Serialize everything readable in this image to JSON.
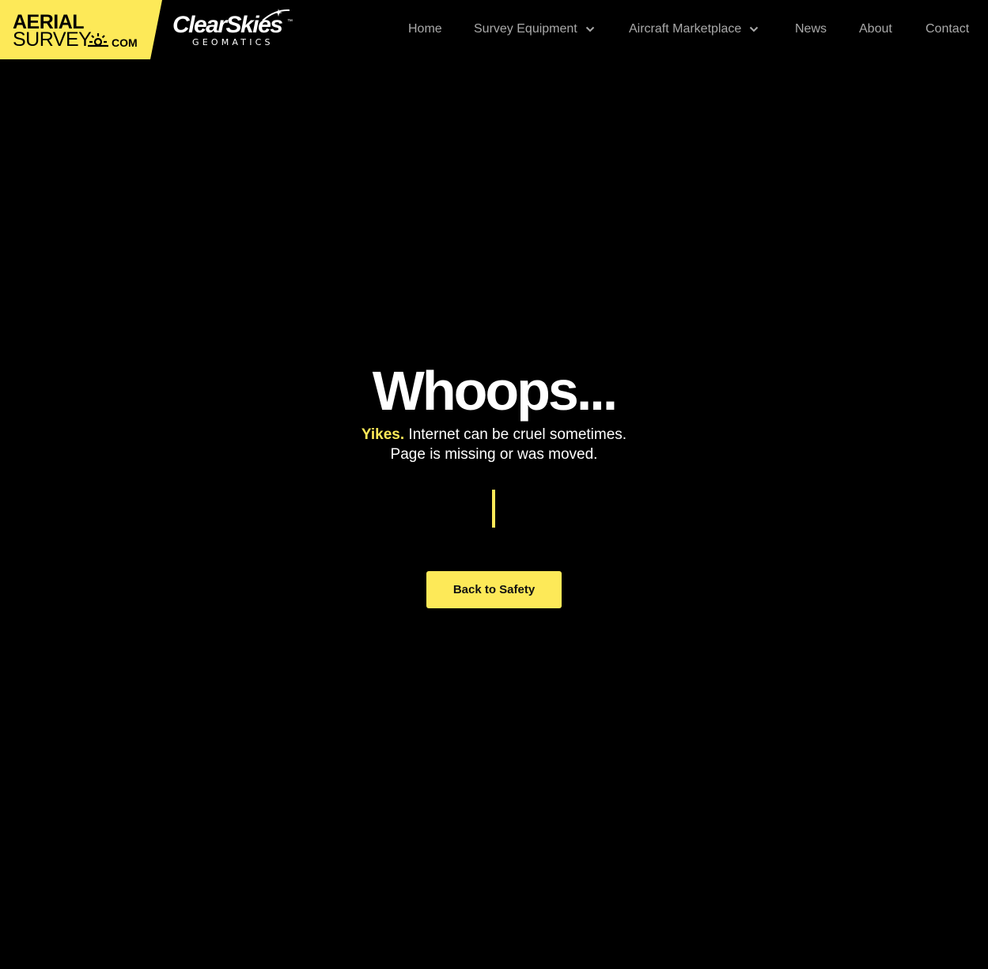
{
  "header": {
    "brand_aerial": {
      "line1": "AERIAL",
      "line2": "SURVEY",
      "suffix": "COM",
      "color": "#fde958"
    },
    "brand_clearskies": {
      "name": "ClearSkies",
      "trademark": "™",
      "tagline": "GEOMATICS"
    },
    "nav": [
      {
        "label": "Home",
        "has_dropdown": false
      },
      {
        "label": "Survey Equipment",
        "has_dropdown": true
      },
      {
        "label": "Aircraft Marketplace",
        "has_dropdown": true
      },
      {
        "label": "News",
        "has_dropdown": false
      },
      {
        "label": "About",
        "has_dropdown": false
      },
      {
        "label": "Contact",
        "has_dropdown": false
      }
    ]
  },
  "main": {
    "title": "Whoops...",
    "highlight": "Yikes.",
    "message_line1": " Internet can be cruel sometimes.",
    "message_line2": "Page is missing or was moved.",
    "button_label": "Back to Safety"
  },
  "colors": {
    "accent": "#fde958",
    "background": "#000000",
    "nav_text": "#a9a9a9"
  },
  "icons": {
    "dropdown": "chevron-down-icon",
    "logo_sun": "sun-icon",
    "logo_swoosh": "swoosh-icon"
  }
}
